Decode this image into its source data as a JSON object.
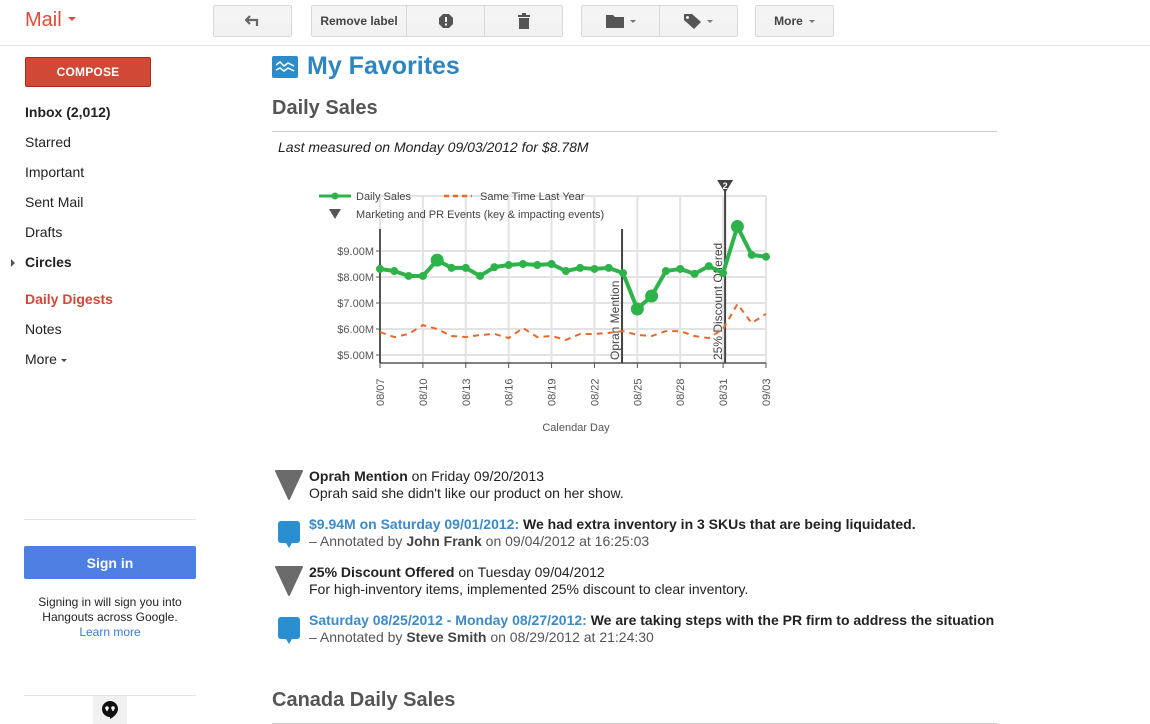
{
  "topbar": {
    "app_name": "Mail",
    "remove_label": "Remove label",
    "more_label": "More",
    "icons": [
      "back-arrow-icon",
      "report-spam-icon",
      "trash-icon",
      "folder-icon",
      "label-tag-icon"
    ]
  },
  "sidebar": {
    "compose_label": "COMPOSE",
    "items": [
      {
        "label": "Inbox (2,012)",
        "style": "bold"
      },
      {
        "label": "Starred",
        "style": "normal"
      },
      {
        "label": "Important",
        "style": "normal"
      },
      {
        "label": "Sent Mail",
        "style": "normal"
      },
      {
        "label": "Drafts",
        "style": "normal"
      },
      {
        "label": "Circles",
        "style": "bold"
      },
      {
        "label": "Daily Digests",
        "style": "active"
      },
      {
        "label": "Notes",
        "style": "normal"
      },
      {
        "label": "More",
        "style": "normal"
      }
    ],
    "signin_label": "Sign in",
    "signin_note": "Signing in will sign you into Hangouts across Google.",
    "learn_more": "Learn more"
  },
  "main": {
    "page_title": "My Favorites",
    "section_title": "Daily Sales",
    "measured_text": "Last measured on Monday 09/03/2012 for $8.78M",
    "next_section_title": "Canada Daily Sales",
    "annotations": [
      {
        "type": "event",
        "title": "Oprah Mention",
        "when": " on Friday 09/20/2013",
        "body": "Oprah said she didn't like our product on her show."
      },
      {
        "type": "comment",
        "link": "$9.94M on Saturday 09/01/2012:",
        "text": " We had extra inventory in 3 SKUs that are being liquidated.",
        "by_prefix": "– Annotated by ",
        "author": "John Frank",
        "by_suffix": " on 09/04/2012 at 16:25:03"
      },
      {
        "type": "event",
        "title": "25% Discount Offered",
        "when": " on Tuesday 09/04/2012",
        "body": "For high-inventory items, implemented 25% discount to clear inventory."
      },
      {
        "type": "comment",
        "link": "Saturday 08/25/2012 - Monday 08/27/2012:",
        "text": " We are taking steps with the PR firm to address the situation",
        "by_prefix": " – Annotated by ",
        "author": "Steve Smith",
        "by_suffix": " on 08/29/2012 at 21:24:30"
      }
    ]
  },
  "colors": {
    "brand_red": "#dd4b39",
    "compose_red": "#d14836",
    "signin_blue": "#4d7fe3",
    "title_blue": "#2e86c1",
    "series_green": "#2db34a",
    "series_orange": "#e8692b",
    "event_gray": "#666666"
  },
  "chart_data": {
    "type": "line",
    "title": "",
    "xlabel": "Calendar Day",
    "ylabel": "",
    "ylim": [
      4.8,
      10.3
    ],
    "yticks": [
      5,
      6,
      7,
      8,
      9
    ],
    "ytick_labels": [
      "$5.00M",
      "$6.00M",
      "$7.00M",
      "$8.00M",
      "$9.00M"
    ],
    "xtick_labels": [
      "08/07",
      "08/10",
      "08/13",
      "08/16",
      "08/19",
      "08/22",
      "08/25",
      "08/28",
      "08/31",
      "09/03"
    ],
    "x": [
      "08/07",
      "08/08",
      "08/09",
      "08/10",
      "08/11",
      "08/12",
      "08/13",
      "08/14",
      "08/15",
      "08/16",
      "08/17",
      "08/18",
      "08/19",
      "08/20",
      "08/21",
      "08/22",
      "08/23",
      "08/24",
      "08/25",
      "08/26",
      "08/27",
      "08/28",
      "08/29",
      "08/30",
      "08/31",
      "09/01",
      "09/02",
      "09/03"
    ],
    "grid": true,
    "legend": {
      "position": "top-left",
      "entries": [
        "Daily Sales",
        "Same Time Last Year",
        "Marketing and PR Events (key & impacting events)"
      ]
    },
    "series": [
      {
        "name": "Daily Sales",
        "style": "solid-markers",
        "values": [
          8.31,
          8.23,
          8.04,
          8.04,
          8.65,
          8.35,
          8.35,
          8.04,
          8.38,
          8.46,
          8.5,
          8.46,
          8.5,
          8.23,
          8.35,
          8.31,
          8.35,
          8.15,
          6.77,
          7.27,
          8.23,
          8.31,
          8.12,
          8.42,
          8.15,
          9.94,
          8.85,
          8.78
        ],
        "highlighted": [
          "08/11",
          "08/25",
          "08/26",
          "09/01"
        ]
      },
      {
        "name": "Same Time Last Year",
        "style": "dashed",
        "values": [
          5.88,
          5.69,
          5.81,
          6.15,
          6.0,
          5.73,
          5.69,
          5.77,
          5.81,
          5.65,
          6.04,
          5.69,
          5.73,
          5.58,
          5.81,
          5.81,
          5.85,
          5.92,
          5.77,
          5.73,
          5.92,
          5.92,
          5.73,
          5.65,
          6.0,
          6.96,
          6.23,
          6.58
        ]
      }
    ],
    "events": [
      {
        "label": "Oprah Mention",
        "x": "08/24"
      },
      {
        "label": "25% Discount Offered",
        "x": "08/31",
        "count_badge": "2"
      }
    ]
  }
}
